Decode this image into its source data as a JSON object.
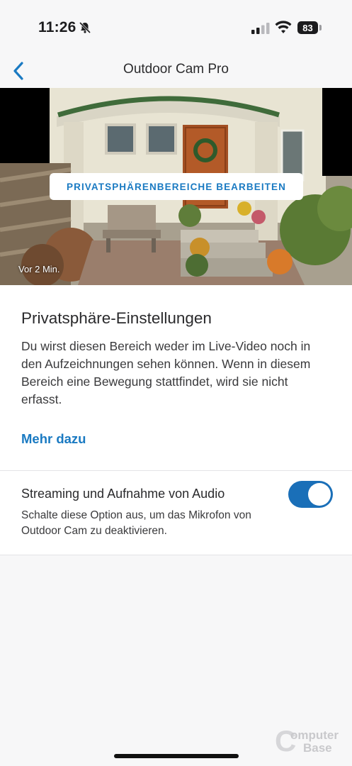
{
  "status_bar": {
    "time": "11:26",
    "battery": "83",
    "icons": [
      "bell-off-icon",
      "signal-icon",
      "wifi-icon",
      "battery-icon"
    ]
  },
  "nav": {
    "title": "Outdoor Cam Pro",
    "back_icon": "chevron-left-icon"
  },
  "camera": {
    "edit_button_label": "PRIVATSPHÄRENBEREICHE BEARBEITEN",
    "timestamp": "Vor 2 Min."
  },
  "privacy": {
    "heading": "Privatsphäre-Einstellungen",
    "text": "Du wirst diesen Bereich weder im Live-Video noch in den Aufzeichnungen sehen können. Wenn in diesem Bereich eine Bewegung stattfindet, wird sie nicht erfasst.",
    "link": "Mehr dazu"
  },
  "audio": {
    "title": "Streaming und Aufnahme von Audio",
    "description": "Schalte diese Option aus, um das Mikrofon von Outdoor Cam zu deaktivieren.",
    "enabled": true
  },
  "watermark": {
    "line1": "omputer",
    "line2": "Base"
  },
  "colors": {
    "accent": "#1a7ac2",
    "toggle_on": "#1a6fb8",
    "background": "#f7f7f8"
  }
}
